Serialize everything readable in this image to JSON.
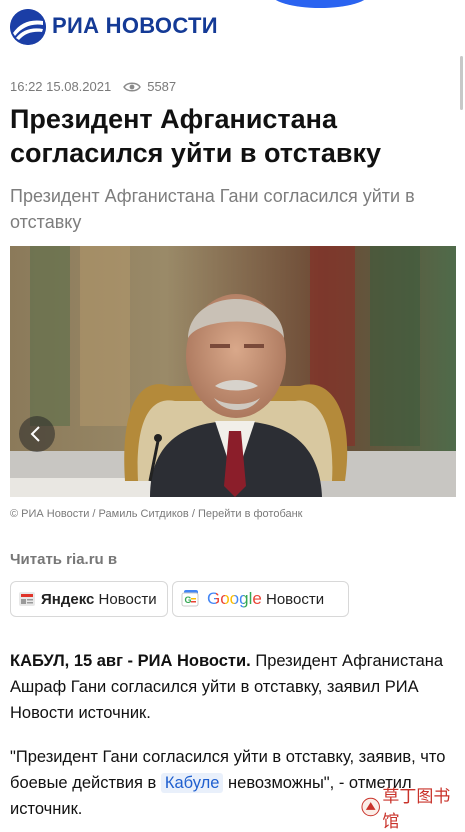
{
  "header": {
    "brand": "РИА НОВОСТИ"
  },
  "article": {
    "time": "16:22 15.08.2021",
    "views": "5587",
    "title": "Президент Афганистана согласился уйти в отставку",
    "subtitle": "Президент Афганистана Гани согласился уйти в отставку",
    "photo_caption": "© РИА Новости / Рамиль Ситдиков / Перейти в фотобанк",
    "read_label": "Читать ria.ru в",
    "lead": {
      "dateline": "КАБУЛ, 15 авг - РИА Новости.",
      "text": " Президент Афганистана Ашраф Гани согласился уйти в отставку, заявил РИА Новости источник."
    },
    "quote": {
      "before": "\"Президент Гани согласился уйти в отставку, заявив, что боевые действия в ",
      "link": "Кабуле",
      "after": " невозможны\", - отметил источник."
    }
  },
  "news_buttons": {
    "yandex_brand": "Яндекс",
    "yandex_label": "Новости",
    "google_brand": "Google",
    "google_label": "Новости"
  },
  "watermark": {
    "text": "草丁图书馆"
  },
  "colors": {
    "brand_blue": "#143a96",
    "accent_blue": "#2a63f0",
    "link_blue": "#1f5fcf",
    "watermark_red": "#c9322a"
  }
}
